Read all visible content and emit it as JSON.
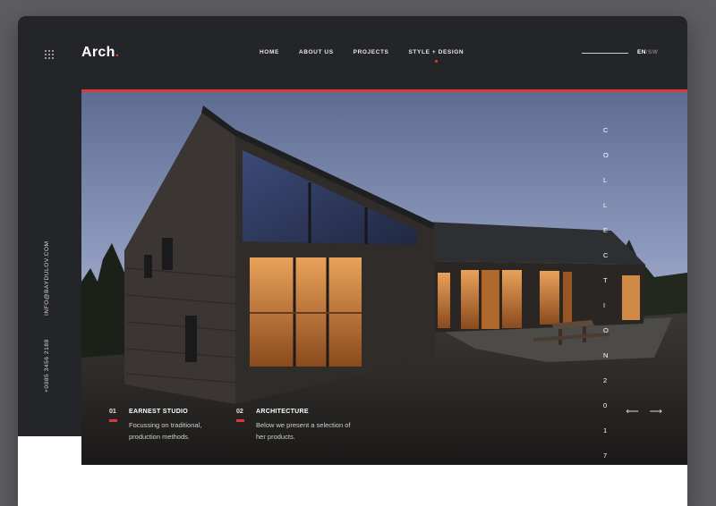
{
  "brand": {
    "name": "Arch",
    "dot": "."
  },
  "nav": {
    "items": [
      "HOME",
      "ABOUT US",
      "PROJECTS",
      "STYLE + DESIGN"
    ],
    "active_index": 3
  },
  "language": {
    "current": "EN",
    "separator": "/",
    "other": "SW"
  },
  "contact": {
    "email": "INFO@BAYDULOV.COM",
    "phone": "+0085 3456 2188"
  },
  "hero": {
    "collection_letters": [
      "C",
      "O",
      "L",
      "L",
      "E",
      "C",
      "T",
      "I",
      "O",
      "N",
      "2",
      "0",
      "1",
      "7"
    ],
    "features": [
      {
        "number": "01",
        "title": "EARNEST STUDIO",
        "description": "Focussing on traditional, production methods."
      },
      {
        "number": "02",
        "title": "ARCHITECTURE",
        "description": "Below we present a selection of her products."
      }
    ],
    "arrows": {
      "prev": "⟵",
      "next": "⟶"
    }
  },
  "colors": {
    "accent": "#e0363b",
    "panel": "#242528",
    "backdrop": "#5e5e62"
  },
  "icons": {
    "menu": "grid-icon",
    "prev": "arrow-left-icon",
    "next": "arrow-right-icon"
  }
}
